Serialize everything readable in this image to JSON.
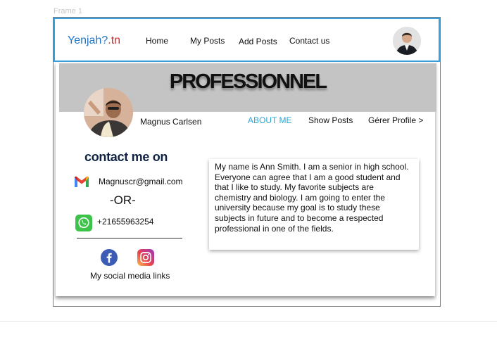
{
  "frame": {
    "label": "Frame 1"
  },
  "header": {
    "logo_main": "Yenjah?",
    "logo_suffix": ".tn",
    "nav": [
      "Home",
      "My Posts",
      "Add Posts",
      "Contact us"
    ]
  },
  "profile": {
    "banner_title": "PROFESSIONNEL",
    "name": "Magnus Carlsen",
    "tabs": {
      "about": "ABOUT ME",
      "posts": "Show Posts",
      "manage": "Gérer Profile >"
    }
  },
  "contact": {
    "title": "contact me on",
    "email": "Magnuscr@gmail.com",
    "or_text": "-OR-",
    "phone": "+21655963254",
    "social_label": "My social media links"
  },
  "bio": {
    "lines": [
      "My name is Ann Smith. I am a senior in high school.",
      "Everyone can agree that I am a good student and",
      "that I like to study. My favorite subjects are",
      "chemistry and biology. I am going to enter the",
      "university because my goal is to study these",
      "subjects in future and to become a respected",
      "professional in one of the fields."
    ]
  },
  "colors": {
    "header_border": "#3aa0db",
    "logo_blue": "#1f75c8",
    "logo_red": "#d22a2a",
    "active_tab": "#2aa6d6",
    "banner": "#c4c4c4"
  },
  "icons": {
    "gmail": "gmail-icon",
    "whatsapp": "whatsapp-icon",
    "facebook": "facebook-icon",
    "instagram": "instagram-icon"
  }
}
